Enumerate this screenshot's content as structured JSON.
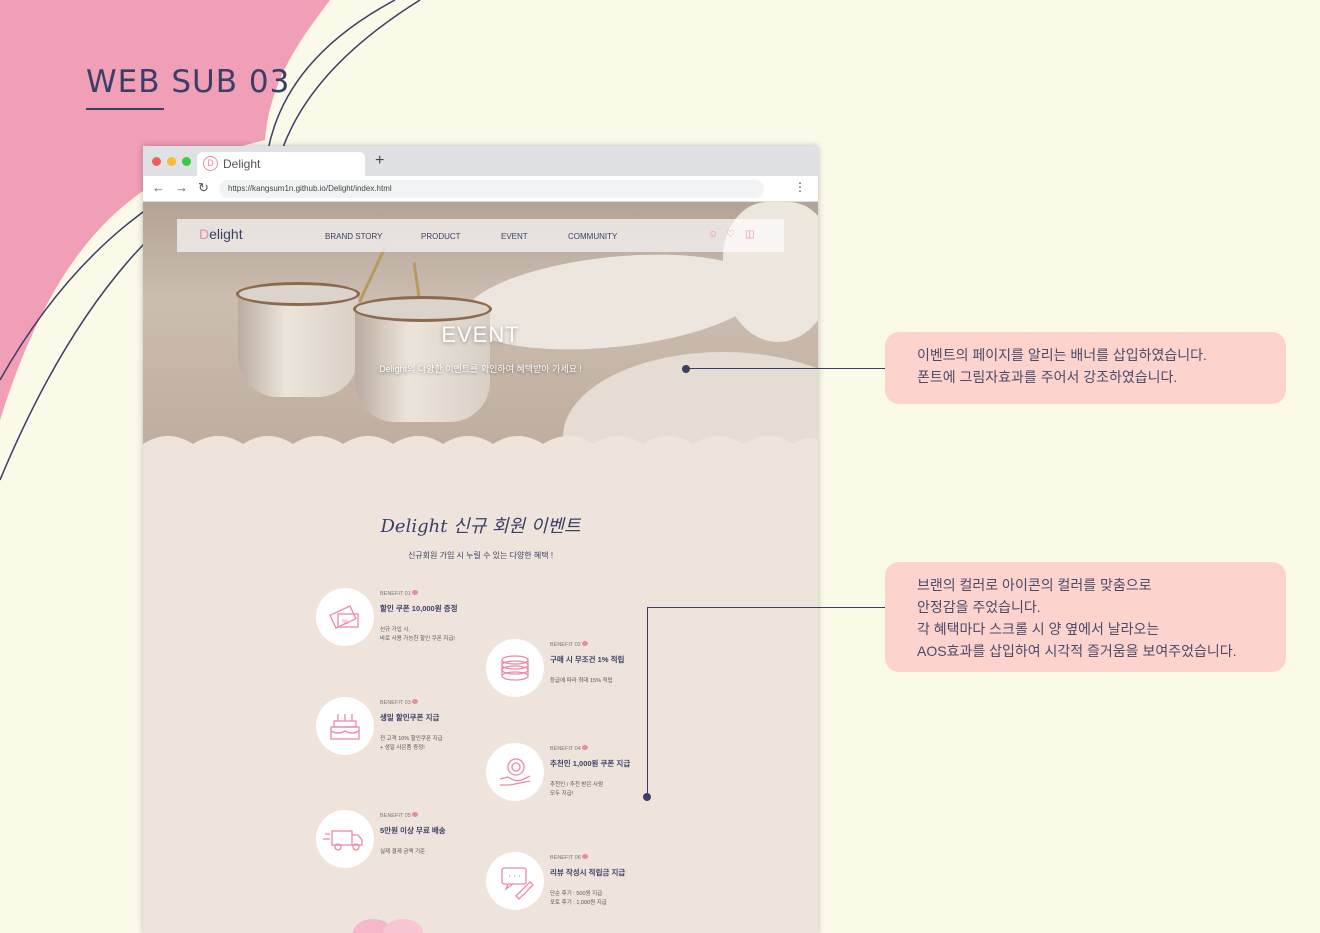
{
  "page_label": "WEB SUB 03",
  "browser": {
    "tab_title": "Delight",
    "new_tab": "+",
    "url": "https://kangsum1n.github.io/Delight/index.html",
    "back": "←",
    "forward": "→",
    "reload": "↻",
    "menu": "⋮"
  },
  "site": {
    "logo": "elight",
    "logo_mark": "D",
    "nav": [
      "BRAND STORY",
      "PRODUCT",
      "EVENT",
      "COMMUNITY"
    ],
    "hero_title": "EVENT",
    "hero_subtitle": "Delight의 다양한 이벤트를 확인하여 혜택받아 가세요 !",
    "section_title": "Delight 신규 회원 이벤트",
    "section_subtitle": "신규회원 가입 시 누릴 수 있는 다양한 혜택 !",
    "benefits": [
      {
        "tag": "BENEFIT 01",
        "icon": "coupon-icon",
        "title": "할인 쿠폰 10,000원 증정",
        "desc": [
          "신규 가입 시,",
          "바로 사용 가능한 할인 쿠폰 지급!"
        ]
      },
      {
        "tag": "BENEFIT 02",
        "icon": "coins-icon",
        "title": "구매 시 무조건 1% 적립",
        "desc": [
          "등급에 따라 최대 15% 적립"
        ]
      },
      {
        "tag": "BENEFIT 03",
        "icon": "cake-icon",
        "title": "생일 할인쿠폰 지급",
        "desc": [
          "전 고객 10% 할인쿠폰 지급",
          "+ 생일 사은품 증정!"
        ]
      },
      {
        "tag": "BENEFIT 04",
        "icon": "referral-icon",
        "title": "추천인 1,000원 쿠폰 지급",
        "desc": [
          "추천인 / 추천 받은 사람",
          "모두 지급!"
        ]
      },
      {
        "tag": "BENEFIT 05",
        "icon": "truck-icon",
        "title": "5만원 이상 무료 배송",
        "desc": [
          "실제 결제 금액 기준"
        ]
      },
      {
        "tag": "BENEFIT 06",
        "icon": "review-icon",
        "title": "리뷰 작성시 적립금 지급",
        "desc": [
          "단순 후기 : 500원 지급",
          "포토 후기 : 1,000원 지급"
        ]
      }
    ]
  },
  "callouts": [
    {
      "lines": [
        "이벤트의 페이지를 알리는 배너를 삽입하였습니다.",
        "폰트에 그림자효과를 주어서 강조하였습니다."
      ]
    },
    {
      "lines": [
        "브랜의 컬러로 아이콘의 컬러를 맞춤으로",
        "안정감을 주었습니다.",
        "각 혜택마다  스크롤 시 양 옆에서 날라오는",
        "AOS효과를 삽입하여 시각적 즐거움을 보여주었습니다."
      ]
    }
  ],
  "colors": {
    "accent": "#e98aa6",
    "navy": "#3b3f66",
    "bg": "#fbf9e8",
    "callout": "#fdd3ce",
    "pink_blob": "#f19eb7"
  }
}
